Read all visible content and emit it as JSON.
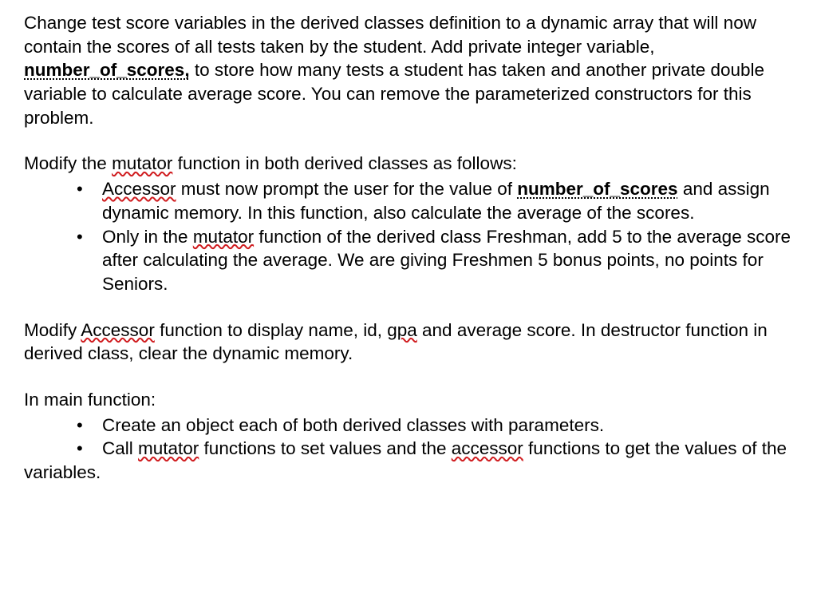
{
  "p1": {
    "t1": "Change test score variables in the derived classes definition to a dynamic array that will now contain the scores of all tests taken by the student. Add private integer variable, ",
    "kw1": "number_of_scores,",
    "t2": " to store how many tests a student has taken and another private double variable to calculate average score. You can remove the parameterized constructors for this problem."
  },
  "p2": {
    "t1": "Modify the ",
    "kw1": "mutator",
    "t2": " function in both derived classes as follows:"
  },
  "bl1": {
    "i1": {
      "kw1": "Accessor",
      "t1": " must now prompt the user for the value of ",
      "kw2": "number_of_scores",
      "t2": " and assign dynamic memory. In this function, also calculate the average of the scores."
    },
    "i2": {
      "t1": "Only in the ",
      "kw1": "mutator",
      "t2": " function of the derived class Freshman, add 5 to the average score after calculating the average. We are giving Freshmen 5 bonus points, no points for Seniors."
    }
  },
  "p3": {
    "t1": "Modify ",
    "kw1": "Accessor",
    "t2": " function to display name, id, ",
    "kw2": "gpa",
    "t3": " and average score. In destructor function in derived class, clear the dynamic memory."
  },
  "p4": {
    "t1": "In main function:"
  },
  "bl2": {
    "i1": {
      "t1": "Create an object each of both derived classes with parameters."
    },
    "i2": {
      "t1": "Call ",
      "kw1": "mutator",
      "t2": " functions to set values and the ",
      "kw2": "accessor",
      "t3": " functions to get the values of the"
    }
  },
  "p5": {
    "t1": "variables."
  }
}
